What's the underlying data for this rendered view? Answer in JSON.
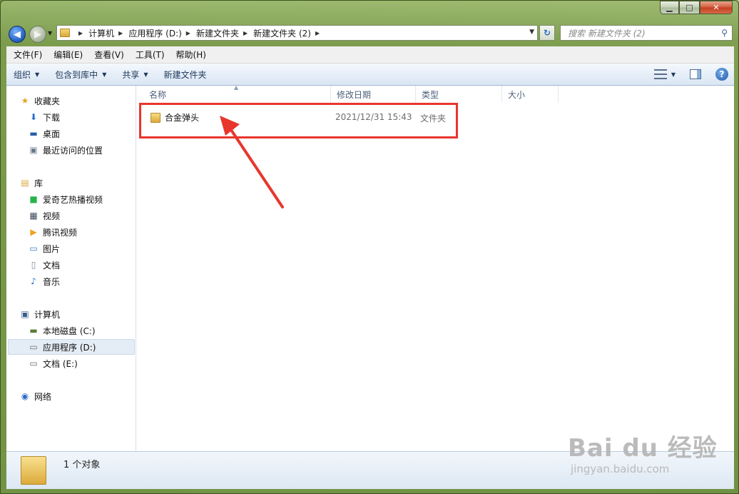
{
  "window": {
    "caption": {
      "minimize": "▁",
      "maximize": "□",
      "close": "✕"
    }
  },
  "address": {
    "crumbs": [
      "计算机",
      "应用程序 (D:)",
      "新建文件夹",
      "新建文件夹 (2)"
    ],
    "search_placeholder": "搜索 新建文件夹 (2)"
  },
  "menubar": [
    "文件(F)",
    "编辑(E)",
    "查看(V)",
    "工具(T)",
    "帮助(H)"
  ],
  "toolbar": {
    "organize": "组织",
    "include_in_library": "包含到库中",
    "share": "共享",
    "new_folder": "新建文件夹"
  },
  "navpane": {
    "favorites": {
      "label": "收藏夹",
      "items": [
        "下载",
        "桌面",
        "最近访问的位置"
      ]
    },
    "libraries": {
      "label": "库",
      "items": [
        "爱奇艺热播视频",
        "视频",
        "腾讯视频",
        "图片",
        "文档",
        "音乐"
      ]
    },
    "computer": {
      "label": "计算机",
      "items": [
        "本地磁盘 (C:)",
        "应用程序 (D:)",
        "文档 (E:)"
      ]
    },
    "network": {
      "label": "网络"
    }
  },
  "columns": {
    "name": "名称",
    "date": "修改日期",
    "type": "类型",
    "size": "大小"
  },
  "files": [
    {
      "name": "合金弹头",
      "date": "2021/12/31 15:43",
      "type": "文件夹",
      "size": ""
    }
  ],
  "status": {
    "count_text": "1 个对象"
  },
  "watermark": {
    "brand": "Bai du 经验",
    "url": "jingyan.baidu.com"
  },
  "colors": {
    "highlight": "#e8362d",
    "toolbar_text": "#1e395b",
    "selected_bg": "#e4ecf5"
  }
}
